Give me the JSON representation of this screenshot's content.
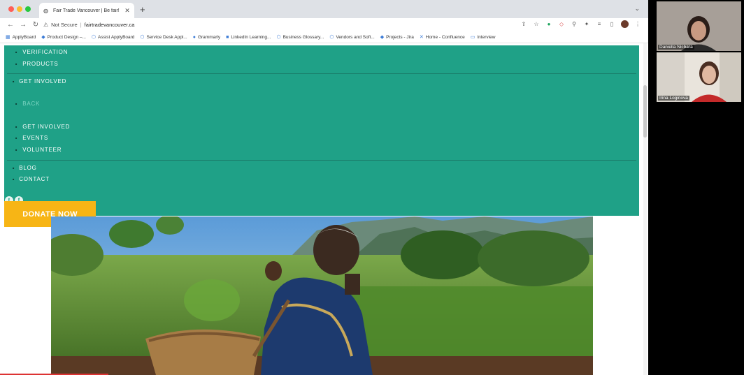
{
  "browser": {
    "tab_title": "Fair Trade Vancouver | Be fair!",
    "tab_close": "✕",
    "new_tab": "+",
    "tab_menu": "⌄",
    "security_label": "Not Secure",
    "url": "fairtradevancouver.ca",
    "nav": {
      "back": "←",
      "forward": "→",
      "reload": "↻"
    }
  },
  "bookmarks": [
    {
      "label": "ApplyBoard",
      "icon": "grid-icon"
    },
    {
      "label": "Product Design –...",
      "icon": "figma-icon"
    },
    {
      "label": "Assist ApplyBoard",
      "icon": "link-icon"
    },
    {
      "label": "Service Desk Appl...",
      "icon": "link-icon"
    },
    {
      "label": "Grammarly",
      "icon": "grammarly-icon"
    },
    {
      "label": "LinkedIn Learning...",
      "icon": "linkedin-icon"
    },
    {
      "label": "Business Glossary...",
      "icon": "link-icon"
    },
    {
      "label": "Vendors and Soft...",
      "icon": "link-icon"
    },
    {
      "label": "Projects - Jira",
      "icon": "jira-icon"
    },
    {
      "label": "Home - Confluence",
      "icon": "confluence-icon"
    },
    {
      "label": "Interview",
      "icon": "folder-icon"
    }
  ],
  "menu": {
    "items": [
      {
        "label": "VERIFICATION"
      },
      {
        "label": "PRODUCTS"
      },
      {
        "label": "GET INVOLVED"
      },
      {
        "label": "BACK"
      },
      {
        "label": "GET INVOLVED"
      },
      {
        "label": "EVENTS"
      },
      {
        "label": "VOLUNTEER"
      },
      {
        "label": "BLOG"
      },
      {
        "label": "CONTACT"
      }
    ]
  },
  "donate_label": "DONATE NOW",
  "participants": [
    {
      "name": "Daniella Nicbara"
    },
    {
      "name": "Irina Loginova"
    }
  ]
}
